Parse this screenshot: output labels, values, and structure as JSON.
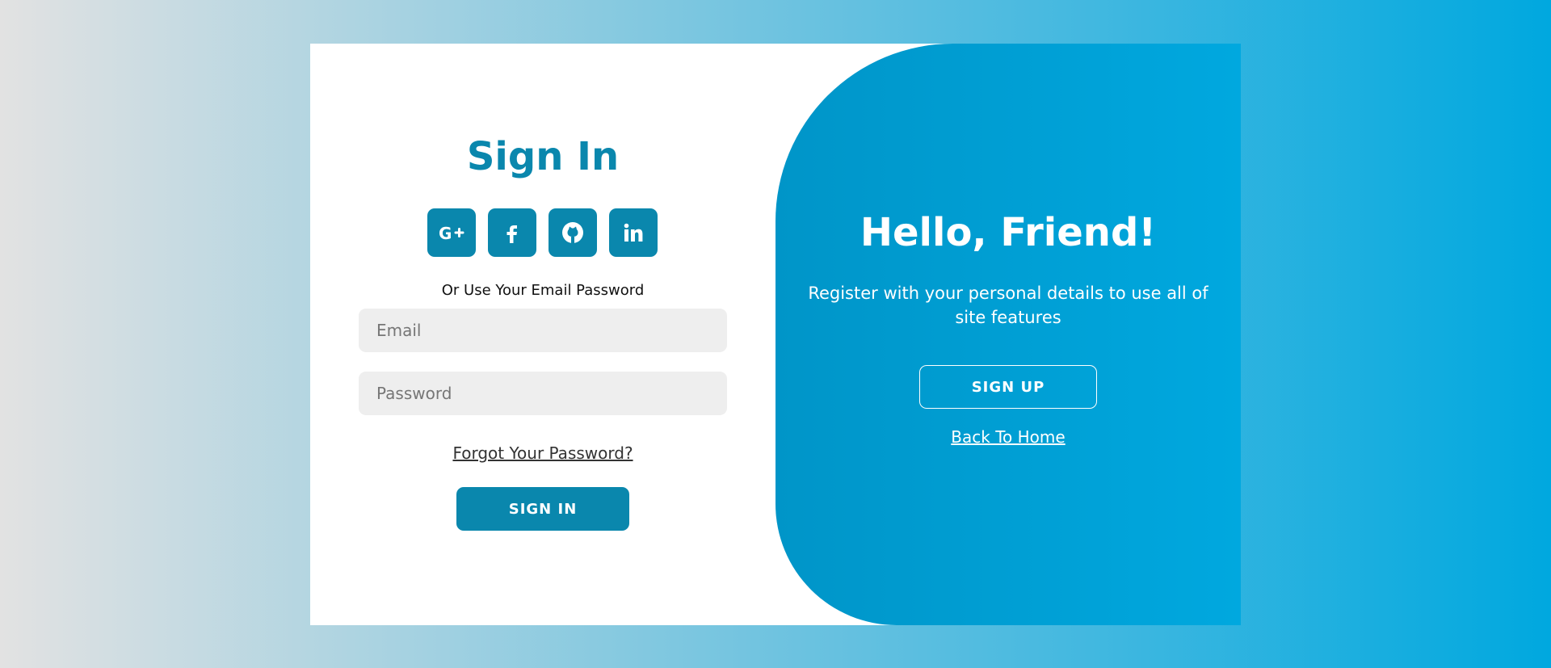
{
  "signin_panel": {
    "title": "Sign In",
    "social_buttons": [
      {
        "icon": "google-plus-icon"
      },
      {
        "icon": "facebook-icon"
      },
      {
        "icon": "github-icon"
      },
      {
        "icon": "linkedin-icon"
      }
    ],
    "alt_text": "Or Use Your Email Password",
    "email_placeholder": "Email",
    "password_placeholder": "Password",
    "forgot_label": "Forgot Your Password?",
    "signin_label": "SIGN IN"
  },
  "signup_panel": {
    "title": "Hello, Friend!",
    "description": "Register with your personal details to use all of site features",
    "signup_label": "SIGN UP",
    "home_label": "Back To Home"
  },
  "colors": {
    "primary": "#0a87ad",
    "panel_start": "#0095c8",
    "panel_end": "#00a8df",
    "input_bg": "#eeeeee"
  }
}
